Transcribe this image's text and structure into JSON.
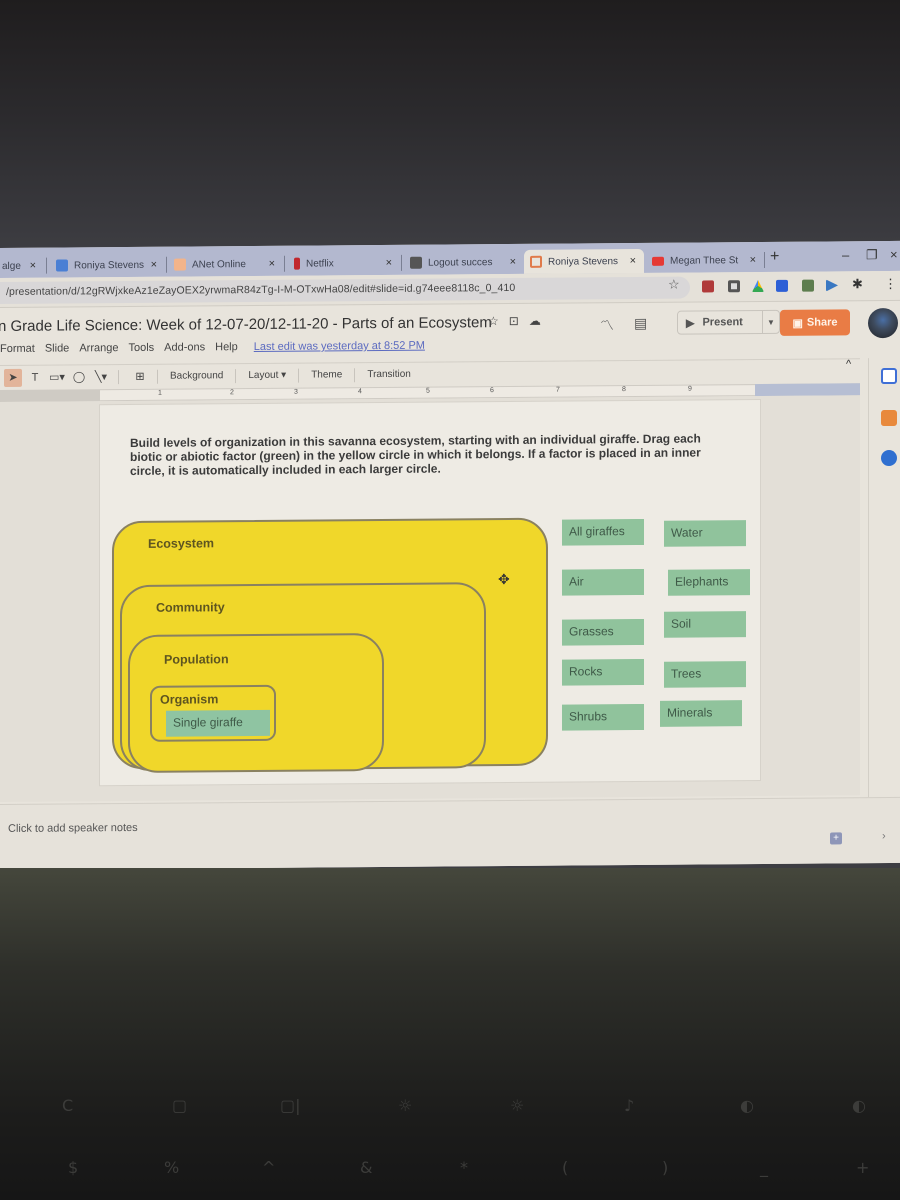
{
  "browser": {
    "tabs": [
      {
        "label": "alge",
        "icon": "generic-tab-icon",
        "active": false
      },
      {
        "label": "Roniya Stevens",
        "icon": "google-docs-icon",
        "active": false
      },
      {
        "label": "ANet Online",
        "icon": "anet-icon",
        "active": false
      },
      {
        "label": "Netflix",
        "icon": "netflix-icon",
        "active": false
      },
      {
        "label": "Logout succes",
        "icon": "logout-icon",
        "active": false
      },
      {
        "label": "Roniya Stevens",
        "icon": "google-slides-icon",
        "active": true
      },
      {
        "label": "Megan Thee St",
        "icon": "youtube-icon",
        "active": false
      }
    ],
    "close_glyph": "×",
    "new_tab_glyph": "+",
    "window_controls": {
      "minimize": "–",
      "restore": "❐",
      "close": "×"
    },
    "url": "/presentation/d/12gRWjxkeAz1eZayOEX2yrwmaR84zTg-I-M-OTxwHa08/edit#slide=id.g74eee8118c_0_410",
    "bookmark_glyph": "☆",
    "menu_glyph": "⋮"
  },
  "document": {
    "title": "n Grade Life Science: Week of 12-07-20/12-11-20 - Parts of an Ecosystem",
    "title_icons": {
      "star": "☆",
      "move": "⊡",
      "cloud": "☁"
    },
    "menu": [
      "Format",
      "Slide",
      "Arrange",
      "Tools",
      "Add-ons",
      "Help"
    ],
    "last_edit": "Last edit was yesterday at 8:52 PM",
    "present_label": "Present",
    "share_label": "Share",
    "colors": {
      "share": "#e97c45",
      "level_fill": "#f0d72a",
      "factor_fill": "#90c39c"
    }
  },
  "toolbar": {
    "background": "Background",
    "layout": "Layout ▾",
    "theme": "Theme",
    "transition": "Transition"
  },
  "ruler": [
    "1",
    "2",
    "3",
    "4",
    "5",
    "6",
    "7",
    "8",
    "9"
  ],
  "slide": {
    "instructions": "Build levels of organization in this savanna ecosystem, starting with an individual giraffe. Drag each biotic or abiotic factor (green) in the yellow circle in which it belongs. If a factor is placed in an inner circle, it is automatically included in each larger circle.",
    "levels": {
      "ecosystem": "Ecosystem",
      "community": "Community",
      "population": "Population",
      "organism": "Organism"
    },
    "placed_factor": "Single giraffe",
    "factors": [
      "All giraffes",
      "Water",
      "Air",
      "Elephants",
      "Grasses",
      "Soil",
      "Rocks",
      "Trees",
      "Shrubs",
      "Minerals"
    ]
  },
  "notes": {
    "placeholder": "Click to add speaker notes"
  },
  "keyboard_glyphs": [
    "C",
    "▢",
    "▢|",
    "☼",
    "☼",
    "♪",
    "◐",
    "◐",
    "$",
    "%",
    "^",
    "&",
    "*",
    "(",
    ")",
    "_",
    "+"
  ]
}
